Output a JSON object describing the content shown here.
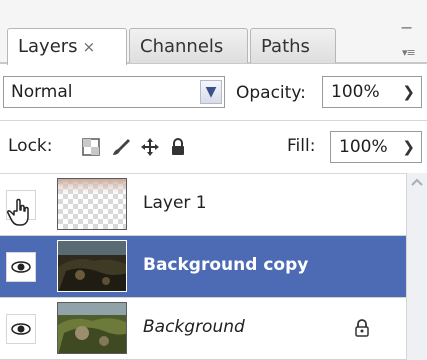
{
  "tabs": {
    "layers": "Layers",
    "layers_close": "×",
    "channels": "Channels",
    "paths": "Paths",
    "panel_menu": "−",
    "flyout_menu": "▾≡"
  },
  "blend": {
    "mode": "Normal",
    "opacity_label": "Opacity:",
    "opacity_value": "100%"
  },
  "lock": {
    "label": "Lock:",
    "fill_label": "Fill:",
    "fill_value": "100%",
    "icons": [
      "lock-transparent-pixels-icon",
      "lock-image-pixels-icon",
      "lock-position-icon",
      "lock-all-icon"
    ]
  },
  "layers": [
    {
      "name": "Layer 1",
      "visible": false,
      "selected": false,
      "thumb": "transparent"
    },
    {
      "name": "Background copy",
      "visible": true,
      "selected": true,
      "thumb": "photo-dark"
    },
    {
      "name": "Background",
      "visible": true,
      "selected": false,
      "thumb": "photo",
      "locked": true
    }
  ],
  "colors": {
    "selection": "#4c6bb4",
    "panel_bg": "#ffffff",
    "tab_bg": "#dedede"
  }
}
